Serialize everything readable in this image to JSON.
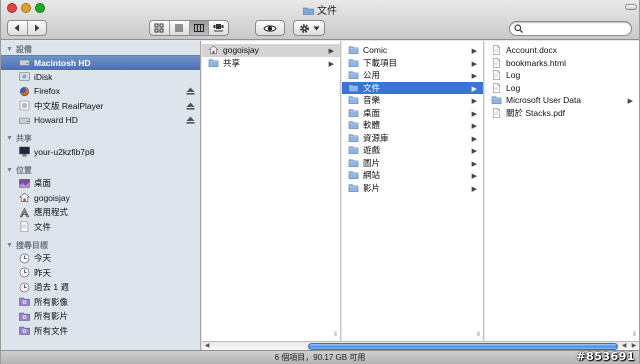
{
  "window": {
    "title": "文件",
    "status": "6 個項目，90.17 GB 可用",
    "colors": {
      "close": "#e0443e",
      "minimize": "#dea123",
      "zoom": "#1aab29",
      "selection": "#3875d7",
      "sidebar_bg": "#dde4ec"
    }
  },
  "toolbar": {
    "back_icon": "back-arrow-icon",
    "forward_icon": "forward-arrow-icon",
    "views": [
      "icon-view-icon",
      "list-view-icon",
      "column-view-icon",
      "coverflow-view-icon"
    ],
    "active_view": "column-view-icon",
    "quicklook_icon": "eye-icon",
    "action_icon": "gear-icon",
    "search": {
      "value": "",
      "placeholder": ""
    }
  },
  "sidebar": {
    "sections": [
      {
        "title": "設備",
        "items": [
          {
            "label": "Macintosh HD",
            "icon": "hard-drive-icon",
            "selected": true,
            "eject": false
          },
          {
            "label": "iDisk",
            "icon": "idisk-icon",
            "selected": false,
            "eject": false
          },
          {
            "label": "Firefox",
            "icon": "firefox-icon",
            "selected": false,
            "eject": true
          },
          {
            "label": "中文版 RealPlayer",
            "icon": "disk-image-icon",
            "selected": false,
            "eject": true
          },
          {
            "label": "Howard HD",
            "icon": "hard-drive-icon",
            "selected": false,
            "eject": true
          }
        ]
      },
      {
        "title": "共享",
        "items": [
          {
            "label": "your-u2kzfib7p8",
            "icon": "monitor-icon",
            "selected": false,
            "eject": false
          }
        ]
      },
      {
        "title": "位置",
        "items": [
          {
            "label": "桌面",
            "icon": "desktop-icon",
            "selected": false,
            "eject": false
          },
          {
            "label": "gogoisjay",
            "icon": "home-icon",
            "selected": false,
            "eject": false
          },
          {
            "label": "應用程式",
            "icon": "applications-icon",
            "selected": false,
            "eject": false
          },
          {
            "label": "文件",
            "icon": "document-icon",
            "selected": false,
            "eject": false
          }
        ]
      },
      {
        "title": "搜尋目標",
        "items": [
          {
            "label": "今天",
            "icon": "clock-icon",
            "selected": false,
            "eject": false
          },
          {
            "label": "昨天",
            "icon": "clock-icon",
            "selected": false,
            "eject": false
          },
          {
            "label": "過去 1 週",
            "icon": "clock-icon",
            "selected": false,
            "eject": false
          },
          {
            "label": "所有影像",
            "icon": "smart-folder-icon",
            "selected": false,
            "eject": false
          },
          {
            "label": "所有影片",
            "icon": "smart-folder-icon",
            "selected": false,
            "eject": false
          },
          {
            "label": "所有文件",
            "icon": "smart-folder-icon",
            "selected": false,
            "eject": false
          }
        ]
      }
    ]
  },
  "columns": [
    {
      "items": [
        {
          "label": "gogoisjay",
          "icon": "home-icon",
          "arrow": true,
          "state": "gray"
        },
        {
          "label": "共享",
          "icon": "folder-icon",
          "arrow": true,
          "state": ""
        }
      ]
    },
    {
      "items": [
        {
          "label": "Comic",
          "icon": "folder-icon",
          "arrow": true,
          "state": ""
        },
        {
          "label": "下載項目",
          "icon": "folder-icon",
          "arrow": true,
          "state": ""
        },
        {
          "label": "公用",
          "icon": "folder-icon",
          "arrow": true,
          "state": ""
        },
        {
          "label": "文件",
          "icon": "folder-icon",
          "arrow": true,
          "state": "blue"
        },
        {
          "label": "音樂",
          "icon": "folder-icon",
          "arrow": true,
          "state": ""
        },
        {
          "label": "桌面",
          "icon": "folder-icon",
          "arrow": true,
          "state": ""
        },
        {
          "label": "軟體",
          "icon": "folder-icon",
          "arrow": true,
          "state": ""
        },
        {
          "label": "資源庫",
          "icon": "folder-icon",
          "arrow": true,
          "state": ""
        },
        {
          "label": "遊戲",
          "icon": "folder-icon",
          "arrow": true,
          "state": ""
        },
        {
          "label": "圖片",
          "icon": "folder-icon",
          "arrow": true,
          "state": ""
        },
        {
          "label": "網站",
          "icon": "folder-icon",
          "arrow": true,
          "state": ""
        },
        {
          "label": "影片",
          "icon": "folder-icon",
          "arrow": true,
          "state": ""
        }
      ]
    },
    {
      "items": [
        {
          "label": "Account.docx",
          "icon": "file-icon",
          "arrow": false,
          "state": ""
        },
        {
          "label": "bookmarks.html",
          "icon": "file-icon",
          "arrow": false,
          "state": ""
        },
        {
          "label": "Log",
          "icon": "file-icon",
          "arrow": false,
          "state": ""
        },
        {
          "label": "Log",
          "icon": "file-icon",
          "arrow": false,
          "state": ""
        },
        {
          "label": "Microsoft User Data",
          "icon": "folder-icon",
          "arrow": true,
          "state": ""
        },
        {
          "label": "關於 Stacks.pdf",
          "icon": "file-icon",
          "arrow": false,
          "state": ""
        }
      ]
    }
  ],
  "watermark": "#853691"
}
